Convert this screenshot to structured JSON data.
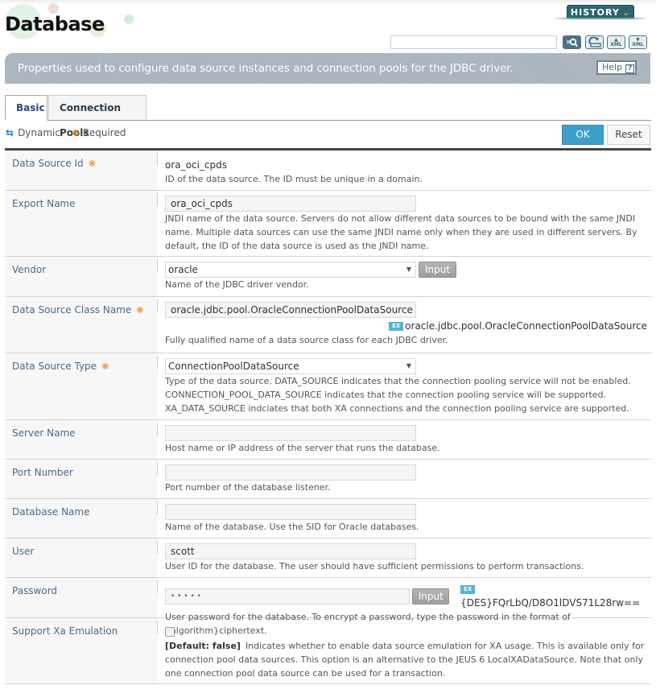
{
  "page": {
    "title": "Database",
    "history_label": "HISTORY",
    "search_placeholder": "",
    "description": "Properties used to configure data source instances and connection pools for the JDBC driver.",
    "help_label": "Help"
  },
  "toolbar": {
    "icons": [
      "search-icon",
      "refresh-icon",
      "xml-export-icon",
      "xml-import-icon"
    ],
    "xml_text": "XML"
  },
  "tabs": [
    {
      "label": "Basic",
      "active": true
    },
    {
      "label": "Connection Pools",
      "active": false
    }
  ],
  "legend": {
    "dynamic_label": "Dynamic",
    "required_label": "Required"
  },
  "actions": {
    "ok_label": "OK",
    "reset_label": "Reset"
  },
  "fields": {
    "data_source_id": {
      "label": "Data Source Id",
      "required": true,
      "value": "ora_oci_cpds",
      "description": "ID of the data source. The ID must be unique in a domain."
    },
    "export_name": {
      "label": "Export Name",
      "value": "ora_oci_cpds",
      "description": "JNDI name of the data source. Servers do not allow different data sources to be bound with the same JNDI name. Multiple data sources can use the same JNDI name only when they are used in different servers. By default, the ID of the data source is used as the JNDI name."
    },
    "vendor": {
      "label": "Vendor",
      "value": "oracle",
      "input_label": "Input",
      "description": "Name of the JDBC driver vendor."
    },
    "data_source_class_name": {
      "label": "Data Source Class Name",
      "required": true,
      "value": "oracle.jdbc.pool.OracleConnectionPoolDataSource",
      "example_badge": "EX",
      "example": "oracle.jdbc.pool.OracleConnectionPoolDataSource",
      "description": "Fully qualified name of a data source class for each JDBC driver."
    },
    "data_source_type": {
      "label": "Data Source Type",
      "required": true,
      "value": "ConnectionPoolDataSource",
      "description": "Type of the data source. DATA_SOURCE indicates that the connection pooling service will not be enabled. CONNECTION_POOL_DATA_SOURCE indicates that the connection pooling service will be supported. XA_DATA_SOURCE indciates that both XA connections and the connection pooling service are supported."
    },
    "server_name": {
      "label": "Server Name",
      "value": "",
      "description": "Host name or IP address of the server that runs the database."
    },
    "port_number": {
      "label": "Port Number",
      "value": "",
      "description": "Port number of the database listener."
    },
    "database_name": {
      "label": "Database Name",
      "value": "",
      "description": "Name of the database. Use the SID for Oracle databases."
    },
    "user": {
      "label": "User",
      "value": "scott",
      "description": "User ID for the database. The user should have sufficient permissions to perform transactions."
    },
    "password": {
      "label": "Password",
      "value": "• • • • •",
      "input_label": "Input",
      "example_badge": "EX",
      "example": "{DES}FQrLbQ/D8O1lDVS71L28rw==",
      "description": "User password for the database. To encrypt a password, type the password in the format of {algorithm}ciphertext."
    },
    "support_xa_emulation": {
      "label": "Support Xa Emulation",
      "checked": false,
      "default_tag": "[Default: false]",
      "description": "Indicates whether to enable data source emulation for XA usage. This is available only for connection pool data sources. This option is an alternative to the JEUS 6 LocalXADataSource. Note that only one connection pool data source can be used for a transaction."
    }
  },
  "colors": {
    "accent_blue": "#3e9fcb",
    "required_orange": "#f08b1c",
    "label_blue": "#4a6a8a",
    "history_teal": "#2f6472",
    "description_bar": "#a9b4bf"
  }
}
